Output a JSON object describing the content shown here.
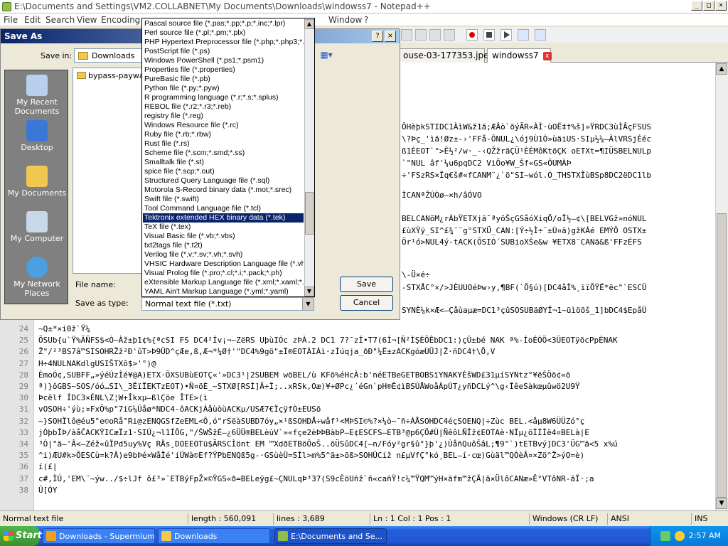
{
  "window": {
    "title": "E:\\Documents and Settings\\VM2.COLLABNET\\My Documents\\Downloads\\windowss7 - Notepad++"
  },
  "menu": [
    "File",
    "Edit",
    "Search",
    "View",
    "Encoding",
    "Window",
    "?"
  ],
  "tabs": [
    {
      "label": "ouse-03-177353.jpeg"
    },
    {
      "label": "windowss7"
    }
  ],
  "editor": {
    "lines": [
      {
        "n": "24",
        "text": "~Q±*×i0ž`Ÿ¼"
      },
      {
        "n": "25",
        "text": "ÕSUb{u`Ÿ%ÃÑFS$<Ó~Àž±þ1¢%{ªcSI FS DC4²Ìv¡¬~ZëRS UþùIÓc zÞÀ.2 DC1 7?¯zÍ•T7(6Í¬[Ñ²ÌŞÉÕÊbDC1:)çÛ±bé NAK ª%-ÍoÉÓÖ<3ÜEOTÿöcPpÉNAK"
      },
      {
        "n": "26",
        "text": "Ž\"/²³BS7â™SISOHRŽž²Ð'ûT>Þ9ÛD^çÆe,ß,Æ¬*¼Ø†'\"DC4%9gö\"±Ï®EOTÀIÀì·zÍúqja_ðÐ\"¼Ë±zACKgóæÙÜJ|Ž·ñDC4†\\Õ,V"
      },
      {
        "n": "27",
        "text": "H÷4NULNAKdlgUSIŠTXô$>'°)@"
      },
      {
        "n": "28",
        "text": "ÉmoÓ¢,SUBFF„»ýéÚzÌé¥@A)ETX·ÖXSUBùEOTÇ«'»DC3¹|2SUBEM wöBEL/ù KFõ%éHcÀ:b'néETBeGETBOBSïYNAKYÉšWD£31µíSYNtz\"¥ëŠÖö¢«ö"
      },
      {
        "n": "29",
        "text": "ª)}ôGBS~SOS/óó…SI\\_3ÊïÏEKTzEOT)•Ñ¤öÈ_~STXØ[RSÌ]Ã÷Ï;..xRSk,Oæ)¥÷ØPc¿´éGn`pH®Ê¢ìBSÚÅWoåÀpÙT¿yñDCLý^\\g‹ÎêeSàkœµûwö2U9Ÿ"
      },
      {
        "n": "30",
        "text": "Þcêlf ÍDC3×ÉNL\\Z¦W+Îkxµ—ßlÇöe ÎTE>(ì"
      },
      {
        "n": "31",
        "text": "vOSOH÷'ýù;¤FxÖ%p\"7iG¼Ûåø*NDC4-ôACKjÁåùòùACKµ/USÆ7€ÏçÿfÒ±EUSö"
      },
      {
        "n": "32",
        "text": "~}SOHÏlô@éu5°e©oRå°Ri@zENQGSfZeEML<Ô,ó\"rSëàSUBD7óy„×¹ßSOHDÅ÷wåf¹<MÞSI©%?×¼ò~¯ñ÷ÀÅSOHDC4éçSOENQ|÷Zùc BEL.<åµ8W6ÜÜZó°ç"
      },
      {
        "n": "33",
        "text": "jÒþbÎÞ/àåĈACKŸICæÏz1·SIÚ¿¬l1ÍÔG,\"/ŠWŠžÉ–¿6ÜÜ®BELèùV`»«fçe2èÞÞBàbP—E¢ESCFS—ETB³@p6ÇÖ#Ù|ÑêôLÑÎž¢EOTAè·NÏµ¿õÌÍÌë4¤BELà|E"
      },
      {
        "n": "34",
        "text": "³Ó|\"ä–'Â<—Zéž«ûÏPd5uy%Vç RÄs¸DOEEOTü$ÃRSCÌönt EM ™XdðETBöÔoŠ..õÜSûDC4[—n/Fóy²gr§û°}þ'¿)ÙåñQuôŠâL;¶9\"`)tETBvý]DC3'ÜG™ä<5 x%ú"
      },
      {
        "n": "35",
        "text": "^i)ÆU#k>ÕESCù=k?Â)e9bÞé×WåÎé'íÜWà©Ef?ŸPbENQß5g-·GSùèÜ=SÍl>m%5^ä±>õß>SOHÛCíž n£µVfÇ°kó¸BEL—í·cœ)Gùäl™QÒèÃ¤×Zö^Ž>ýO=è)"
      },
      {
        "n": "36",
        "text": "í(£|"
      },
      {
        "n": "37",
        "text": "c#,ÌÚ,'EM\\¨~ýw../$÷lJf ô£³»¯ETBýFpŽ×©ŸGS«ð=BELeÿg£~ÇNULqÞ³37(S9cÈöUñž`ñ«cañŸ!c¼™ŸQM™ýH×ãfm™žÇÄ|ä×ÜlôCANæ»Ê°VTôNR-ãÏ·;a"
      },
      {
        "n": "38",
        "text": "Û[ÓY"
      }
    ],
    "upper": [
      "ÔHèþkSTIDC1ÀìW&ž1ã;ÆÂò`õýÃR«ÀÌ·ùOË‡†%š]»ŸRDC3ùÌÂçFSUS",
      "\\?Þç_'ìä!Øz±-›'FFå-ÔNUL¿\\ój9Ù1Ò»ùäiUS·SIµ½¼—ÀlVRSjÉéc",
      "ß1ÉEOT`°>Ê½²/w·_-‹QŽžräÇÜ¹ÈÉMôKtöÇK oETXt=¶IÜSBELNULp",
      "`\"NUL âf'¼u6pqDC2 ViÕo¥W_Šf«GS«ÔUMÀÞ",
      "÷'FSzRS×Ïq€š#«fCANM¨¿`ö\"SI~wól.Ó_THSTXÎùBSp8DC2ëDC1lb"
    ],
    "upper2": [
      "ÌCANªŽÚÒø—×h/âÓVO",
      "BELCANõM¿rÁbŸETXjä¯ªyöŠçGSåóXiqÕ/oÎ½–¢\\[BELVGž»nóNUL",
      "£ùXŸÿ_SI^£¾¨¨g°STXÜ_CAN:[Ý÷½Ì÷¨±Ù¤ä)gžKÁé EMÝÔ OSTX±",
      "Ör¹ó>NUL4ý-tACK(ÕSIÓ´SUBioXŠe&w ¥ETX8¨CANä&ß'FFzÉFS",
      "\\-Ü×é÷",
      "-STXÅC°×/>JÈUUOéÞw›y,¶BF(`Õ§ú)[DC4åÌ%¸ïïÕŸË*ëc\"`ESCÜ",
      "SYNÈ¼k×Æ<—Çåùaµæ=DC1³çûSOSUBäØYÎ¬1~üìöõš_1]bDC4$EpåÜ"
    ]
  },
  "status": {
    "type": "Normal text file",
    "length": "length : 560,091",
    "lines": "lines : 3,689",
    "pos": "Ln : 1   Col : 1   Pos : 1",
    "eol": "Windows (CR LF)",
    "enc": "ANSI",
    "ins": "INS"
  },
  "dialog": {
    "title": "Save As",
    "save_in_label": "Save in:",
    "save_in_value": "Downloads",
    "file_item": "bypass-paywalls",
    "places": [
      "My Recent Documents",
      "Desktop",
      "My Documents",
      "My Computer",
      "My Network Places"
    ],
    "file_name_label": "File name:",
    "save_as_type_label": "Save as type:",
    "save_as_type_value": "Normal text file (*.txt)",
    "save_button": "Save",
    "cancel_button": "Cancel",
    "help_button": "?",
    "close_button": "×"
  },
  "dropdown": {
    "options": [
      "Pascal source file (*.pas;*.pp;*.p;*.inc;*.lpr)",
      "Perl source file (*.pl;*.pm;*.plx)",
      "PHP Hypertext Preprocessor file (*.php;*.php3;*.",
      "PostScript file (*.ps)",
      "Windows PowerShell (*.ps1;*.psm1)",
      "Properties file (*.properties)",
      "PureBasic file (*.pb)",
      "Python file (*.py;*.pyw)",
      "R programming language (*.r;*.s;*.splus)",
      "REBOL file (*.r2;*.r3;*.reb)",
      "registry file (*.reg)",
      "Windows Resource file (*.rc)",
      "Ruby file (*.rb;*.rbw)",
      "Rust file (*.rs)",
      "Scheme file (*.scm;*.smd;*.ss)",
      "Smalltalk file (*.st)",
      "spice file (*.scp;*.out)",
      "Structured Query Language file (*.sql)",
      "Motorola S-Record binary data (*.mot;*.srec)",
      "Swift file (*.swift)",
      "Tool Command Language file (*.tcl)",
      "Tektronix extended HEX binary data (*.tek)",
      "TeX file (*.tex)",
      "Visual Basic file (*.vb;*.vbs)",
      "txt2tags file (*.t2t)",
      "Verilog file (*.v;*.sv;*.vh;*.svh)",
      "VHSIC Hardware Description Language file (*.vh",
      "Visual Prolog file (*.pro;*.cl;*.i;*.pack;*.ph)",
      "eXtensible Markup Language file (*.xml;*.xaml;*.",
      "YAML Ain't Markup Language (*.yml;*.yaml)"
    ],
    "selected_index": 21
  },
  "taskbar": {
    "start": "Start",
    "tasks": [
      "Downloads - Supermium",
      "Downloads",
      "E:\\Documents and Se..."
    ],
    "clock": "2:57 AM"
  },
  "colors": {
    "selection": "#0a246a",
    "taskbar": "#245edb",
    "start": "#3c8f30"
  }
}
